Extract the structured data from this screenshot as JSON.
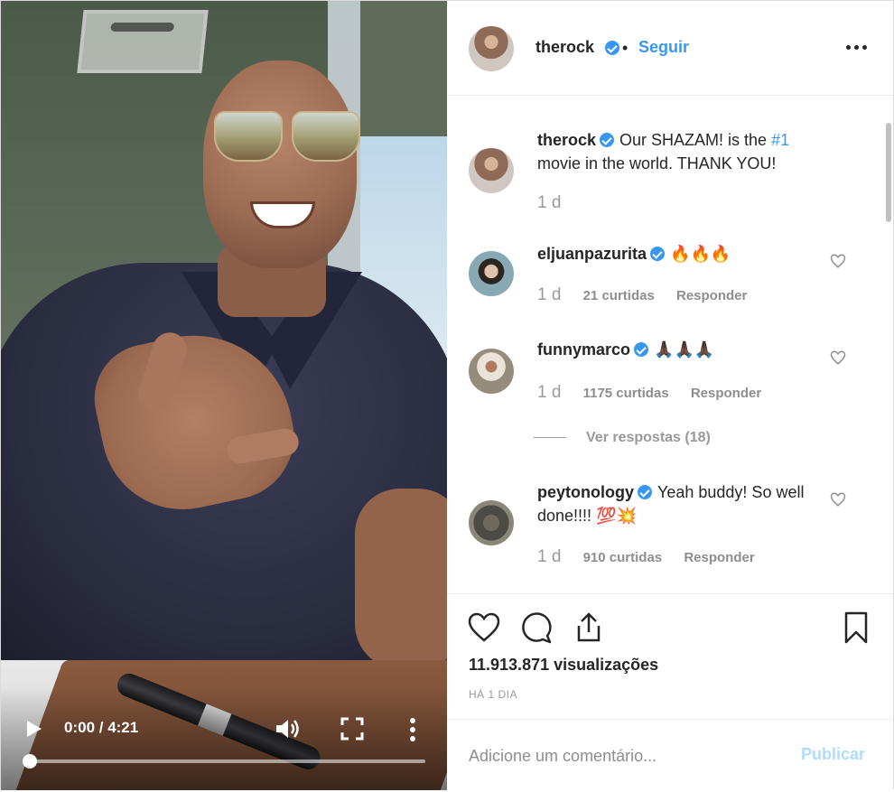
{
  "video": {
    "time": "0:00 / 4:21",
    "progress_fraction": 0.0
  },
  "post": {
    "username": "therock",
    "follow_label": "Seguir",
    "separator": "•",
    "caption_user": "therock",
    "caption_text_before": "Our SHAZAM! is the ",
    "caption_hashtag": "#1",
    "caption_text_after": " movie in the world. THANK YOU!",
    "caption_age": "1 d"
  },
  "comments": [
    {
      "user": "eljuanpazurita",
      "text": "🔥🔥🔥",
      "age": "1 d",
      "likes": "21 curtidas",
      "reply": "Responder"
    },
    {
      "user": "funnymarco",
      "text": "🙏🏿🙏🏿🙏🏿",
      "age": "1 d",
      "likes": "1175 curtidas",
      "reply": "Responder"
    },
    {
      "user": "peytonology",
      "text": "Yeah buddy! So well done!!!! 💯💥",
      "age": "1 d",
      "likes": "910 curtidas",
      "reply": "Responder"
    }
  ],
  "view_replies": "Ver respostas (18)",
  "stats": {
    "views": "11.913.871 visualizações",
    "posted": "HÁ 1 DIA"
  },
  "add_comment": {
    "placeholder": "Adicione um comentário...",
    "publish_label": "Publicar"
  },
  "colors": {
    "accent": "#3897f0",
    "publish_disabled": "#b3dbff",
    "muted": "#999999"
  },
  "icons": [
    "play-icon",
    "volume-icon",
    "fullscreen-icon",
    "more-vertical-icon",
    "verified-badge-icon",
    "more-horizontal-icon",
    "heart-icon",
    "comment-icon",
    "share-icon",
    "bookmark-icon"
  ]
}
